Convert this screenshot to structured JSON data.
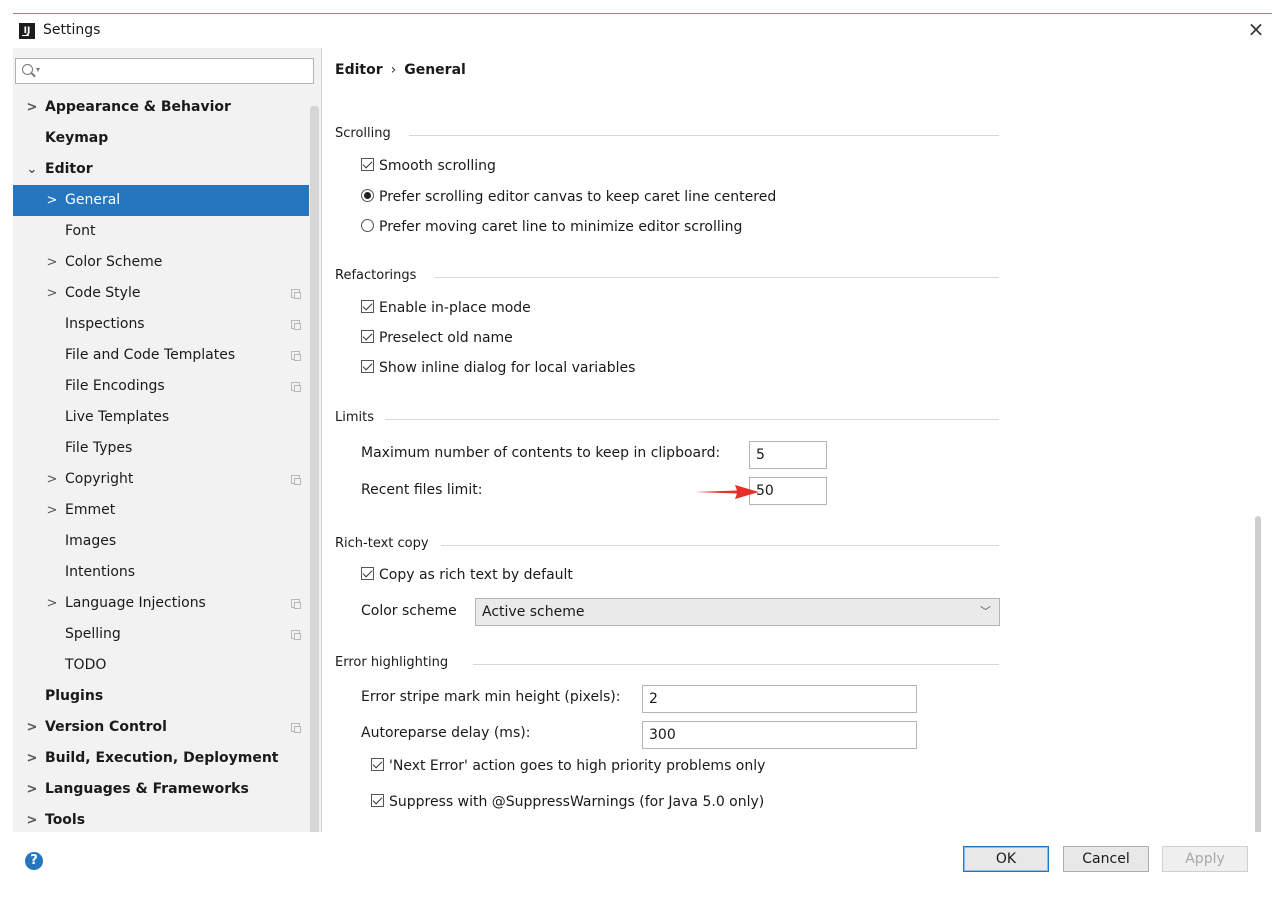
{
  "window": {
    "title": "Settings"
  },
  "search": {
    "placeholder": ""
  },
  "tree": [
    {
      "label": "Appearance & Behavior",
      "level": 0,
      "arrow": ">",
      "bold": true,
      "copy": false,
      "selected": false
    },
    {
      "label": "Keymap",
      "level": 0,
      "arrow": "",
      "bold": true,
      "copy": false,
      "selected": false
    },
    {
      "label": "Editor",
      "level": 0,
      "arrow": "⌄",
      "bold": true,
      "copy": false,
      "selected": false
    },
    {
      "label": "General",
      "level": 1,
      "arrow": ">",
      "bold": false,
      "copy": false,
      "selected": true
    },
    {
      "label": "Font",
      "level": 1,
      "arrow": "",
      "bold": false,
      "copy": false,
      "selected": false
    },
    {
      "label": "Color Scheme",
      "level": 1,
      "arrow": ">",
      "bold": false,
      "copy": false,
      "selected": false
    },
    {
      "label": "Code Style",
      "level": 1,
      "arrow": ">",
      "bold": false,
      "copy": true,
      "selected": false
    },
    {
      "label": "Inspections",
      "level": 1,
      "arrow": "",
      "bold": false,
      "copy": true,
      "selected": false
    },
    {
      "label": "File and Code Templates",
      "level": 1,
      "arrow": "",
      "bold": false,
      "copy": true,
      "selected": false
    },
    {
      "label": "File Encodings",
      "level": 1,
      "arrow": "",
      "bold": false,
      "copy": true,
      "selected": false
    },
    {
      "label": "Live Templates",
      "level": 1,
      "arrow": "",
      "bold": false,
      "copy": false,
      "selected": false
    },
    {
      "label": "File Types",
      "level": 1,
      "arrow": "",
      "bold": false,
      "copy": false,
      "selected": false
    },
    {
      "label": "Copyright",
      "level": 1,
      "arrow": ">",
      "bold": false,
      "copy": true,
      "selected": false
    },
    {
      "label": "Emmet",
      "level": 1,
      "arrow": ">",
      "bold": false,
      "copy": false,
      "selected": false
    },
    {
      "label": "Images",
      "level": 1,
      "arrow": "",
      "bold": false,
      "copy": false,
      "selected": false
    },
    {
      "label": "Intentions",
      "level": 1,
      "arrow": "",
      "bold": false,
      "copy": false,
      "selected": false
    },
    {
      "label": "Language Injections",
      "level": 1,
      "arrow": ">",
      "bold": false,
      "copy": true,
      "selected": false
    },
    {
      "label": "Spelling",
      "level": 1,
      "arrow": "",
      "bold": false,
      "copy": true,
      "selected": false
    },
    {
      "label": "TODO",
      "level": 1,
      "arrow": "",
      "bold": false,
      "copy": false,
      "selected": false
    },
    {
      "label": "Plugins",
      "level": 0,
      "arrow": "",
      "bold": true,
      "copy": false,
      "selected": false
    },
    {
      "label": "Version Control",
      "level": 0,
      "arrow": ">",
      "bold": true,
      "copy": true,
      "selected": false
    },
    {
      "label": "Build, Execution, Deployment",
      "level": 0,
      "arrow": ">",
      "bold": true,
      "copy": false,
      "selected": false
    },
    {
      "label": "Languages & Frameworks",
      "level": 0,
      "arrow": ">",
      "bold": true,
      "copy": false,
      "selected": false
    },
    {
      "label": "Tools",
      "level": 0,
      "arrow": ">",
      "bold": true,
      "copy": false,
      "selected": false
    }
  ],
  "breadcrumb": {
    "parent": "Editor",
    "sep": "›",
    "current": "General"
  },
  "scrolling": {
    "title": "Scrolling",
    "smooth": {
      "label": "Smooth scrolling",
      "checked": true
    },
    "prefer_centered": {
      "label": "Prefer scrolling editor canvas to keep caret line centered",
      "checked": true
    },
    "prefer_moving": {
      "label": "Prefer moving caret line to minimize editor scrolling",
      "checked": false
    }
  },
  "refactorings": {
    "title": "Refactorings",
    "in_place": {
      "label": "Enable in-place mode",
      "checked": true
    },
    "preselect": {
      "label": "Preselect old name",
      "checked": true
    },
    "inline_dialog": {
      "label": "Show inline dialog for local variables",
      "checked": true
    }
  },
  "limits": {
    "title": "Limits",
    "clipboard_label": "Maximum number of contents to keep in clipboard:",
    "clipboard_value": "5",
    "recent_label": "Recent files limit:",
    "recent_value": "50"
  },
  "rich_text": {
    "title": "Rich-text copy",
    "copy_rich": {
      "label": "Copy as rich text by default",
      "checked": true
    },
    "scheme_label": "Color scheme",
    "scheme_value": "Active scheme"
  },
  "error_highlighting": {
    "title": "Error highlighting",
    "stripe_label": "Error stripe mark min height (pixels):",
    "stripe_value": "2",
    "autoreparse_label": "Autoreparse delay (ms):",
    "autoreparse_value": "300",
    "next_error": {
      "label": "'Next Error' action goes to high priority problems only",
      "checked": true
    },
    "suppress": {
      "label": "Suppress with @SuppressWarnings (for Java 5.0 only)",
      "checked": true
    }
  },
  "footer": {
    "help": "?",
    "ok": "OK",
    "cancel": "Cancel",
    "apply": "Apply"
  },
  "colors": {
    "selection": "#2675bf",
    "arrow": "#e8302a",
    "sidebar_bg": "#f2f2f2"
  }
}
